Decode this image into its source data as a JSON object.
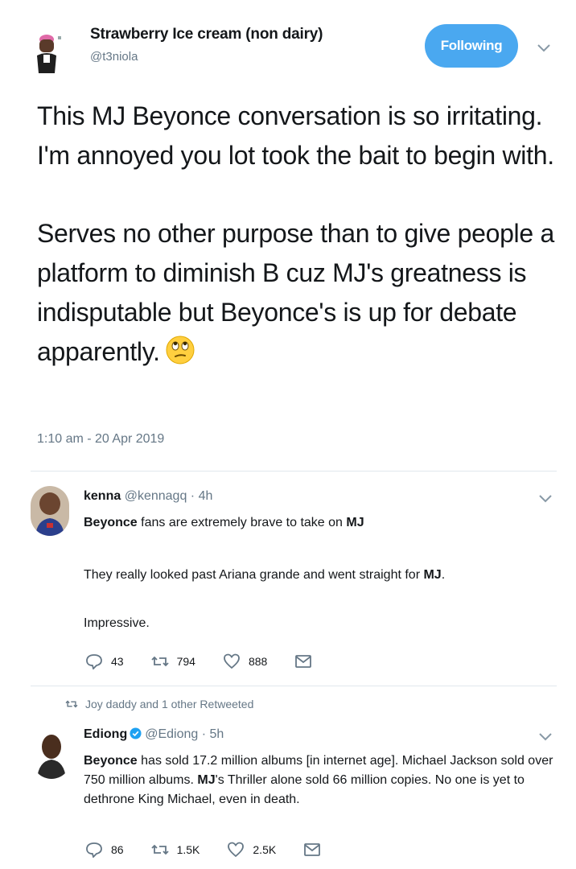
{
  "main_tweet": {
    "display_name": "Strawberry Ice cream (non dairy)",
    "handle": "@t3niola",
    "follow_label": "Following",
    "paragraph_1": "This MJ Beyonce conversation is so irritating. I'm annoyed you lot took the bait to begin with.",
    "paragraph_2": "Serves no other purpose than to give people a platform to diminish B cuz MJ's greatness is indisputable but Beyonce's is up for debate apparently.",
    "emoji_icon": "eye-roll-face-icon",
    "timestamp": "1:10 am - 20 Apr 2019"
  },
  "replies": [
    {
      "display_name": "kenna",
      "handle": "@kennagq",
      "age": "4h",
      "line_1": {
        "bold_start": "Beyonce",
        "middle": " fans are extremely brave to take on ",
        "bold_end": "MJ"
      },
      "line_2": {
        "text": "They really looked past Ariana grande and went straight for ",
        "bold_end": "MJ",
        "tail": "."
      },
      "line_3": "Impressive.",
      "reply_count": "43",
      "retweet_count": "794",
      "like_count": "888"
    },
    {
      "retweet_note": "Joy daddy and 1 other Retweeted",
      "display_name": "Ediong",
      "handle": "@Ediong",
      "age": "5h",
      "verified": true,
      "body": {
        "b1": "Beyonce",
        "t1": " has sold 17.2 million albums [in internet age]. Michael Jackson sold over 750 million albums. ",
        "b2": "MJ",
        "t2": "'s Thriller alone sold 66 million copies. No one is yet to dethrone King Michael, even in death."
      },
      "reply_count": "86",
      "retweet_count": "1.5K",
      "like_count": "2.5K"
    }
  ],
  "colors": {
    "accent": "#4aa8f0",
    "secondary_text": "#657786",
    "verified": "#1da1f2"
  }
}
